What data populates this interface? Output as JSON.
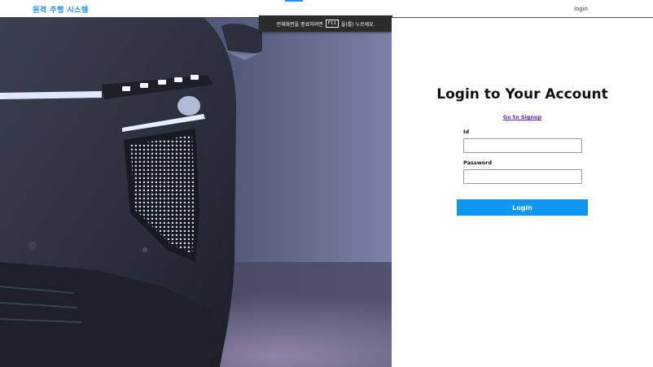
{
  "nav": {
    "brand": "원격 주행 시스템",
    "login_link": "login"
  },
  "fullscreen_notice": {
    "before": "전체화면을 종료하려면",
    "key": "F11",
    "after": "을(를) 누르세요."
  },
  "hero": {
    "image_subject": "car-front-headlight"
  },
  "login": {
    "title": "Login to Your Account",
    "signup_link": "Go to Signup",
    "id_label": "Id",
    "id_value": "",
    "password_label": "Password",
    "password_value": "",
    "submit_label": "Login"
  },
  "colors": {
    "brand": "#1a8fe3",
    "primary_button": "#0d96f2",
    "signup_link": "#5a2ca0"
  }
}
